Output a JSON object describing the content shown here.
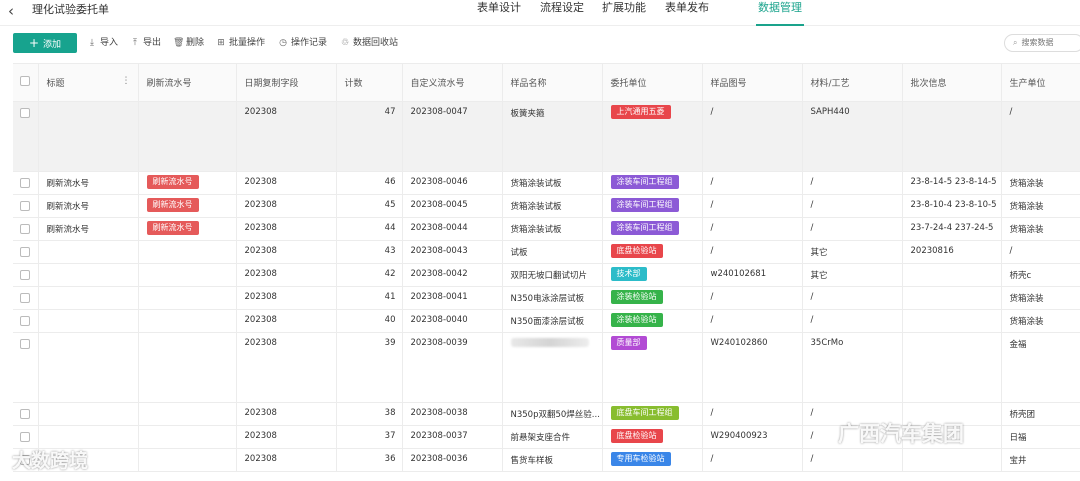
{
  "header": {
    "title": "理化试验委托单",
    "tabs": [
      "表单设计",
      "流程设定",
      "扩展功能",
      "表单发布",
      "数据管理"
    ],
    "active_tab": "数据管理"
  },
  "toolbar": {
    "add": "添加",
    "import": "导入",
    "export": "导出",
    "delete": "删除",
    "batch": "批量操作",
    "log": "操作记录",
    "recycle": "数据回收站",
    "search_placeholder": "搜索数据"
  },
  "columns": [
    "标题",
    "刷新流水号",
    "日期复制字段",
    "计数",
    "自定义流水号",
    "样品名称",
    "委托单位",
    "样品图号",
    "材料/工艺",
    "批次信息",
    "生产单位"
  ],
  "tag_colors": {
    "上汽通用五菱": "#e8464b",
    "刷新流水号": "#e55a5a",
    "涂装车间工程组": "#8c5ad6",
    "底盘检验站": "#e8464b",
    "技术部": "#2cbcc9",
    "涂装检验站": "#36b34a",
    "质量部": "#b24bd4",
    "底盘车间工程组": "#88bd2f",
    "专用车检验站": "#3a86e8"
  },
  "rows": [
    {
      "title": "",
      "refresh": "",
      "date": "202308",
      "count": "47",
      "serial": "202308-0047",
      "sample": "板簧夹箍",
      "unit": "上汽通用五菱",
      "drawing": "/",
      "material": "SAPH440",
      "batch": "",
      "producer": "/"
    },
    {
      "title": "刷新流水号",
      "refresh": "刷新流水号",
      "date": "202308",
      "count": "46",
      "serial": "202308-0046",
      "sample": "货箱涂装试板",
      "unit": "涂装车间工程组",
      "drawing": "/",
      "material": "/",
      "batch": "23-8-14-5   23-8-14-5",
      "producer": "货箱涂装"
    },
    {
      "title": "刷新流水号",
      "refresh": "刷新流水号",
      "date": "202308",
      "count": "45",
      "serial": "202308-0045",
      "sample": "货箱涂装试板",
      "unit": "涂装车间工程组",
      "drawing": "/",
      "material": "/",
      "batch": "23-8-10-4   23-8-10-5",
      "producer": "货箱涂装"
    },
    {
      "title": "刷新流水号",
      "refresh": "刷新流水号",
      "date": "202308",
      "count": "44",
      "serial": "202308-0044",
      "sample": "货箱涂装试板",
      "unit": "涂装车间工程组",
      "drawing": "/",
      "material": "/",
      "batch": "23-7-24-4   237-24-5",
      "producer": "货箱涂装"
    },
    {
      "title": "",
      "refresh": "",
      "date": "202308",
      "count": "43",
      "serial": "202308-0043",
      "sample": "试板",
      "unit": "底盘检验站",
      "drawing": "/",
      "material": "其它",
      "batch": "20230816",
      "producer": "/"
    },
    {
      "title": "",
      "refresh": "",
      "date": "202308",
      "count": "42",
      "serial": "202308-0042",
      "sample": "双阳无坡口翻试切片",
      "unit": "技术部",
      "drawing": "w240102681",
      "material": "其它",
      "batch": "",
      "producer": "桥壳c"
    },
    {
      "title": "",
      "refresh": "",
      "date": "202308",
      "count": "41",
      "serial": "202308-0041",
      "sample": "N350电泳涂层试板",
      "unit": "涂装检验站",
      "drawing": "/",
      "material": "/",
      "batch": "",
      "producer": "货箱涂装"
    },
    {
      "title": "",
      "refresh": "",
      "date": "202308",
      "count": "40",
      "serial": "202308-0040",
      "sample": "N350面漆涂层试板",
      "unit": "涂装检验站",
      "drawing": "/",
      "material": "/",
      "batch": "",
      "producer": "货箱涂装"
    },
    {
      "title": "",
      "refresh": "",
      "date": "202308",
      "count": "39",
      "serial": "202308-0039",
      "sample": "",
      "unit": "质量部",
      "drawing": "W240102860",
      "material": "35CrMo",
      "batch": "",
      "producer": "金福"
    },
    {
      "title": "",
      "refresh": "",
      "date": "202308",
      "count": "38",
      "serial": "202308-0038",
      "sample": "N350p双翻50焊丝验...",
      "unit": "底盘车间工程组",
      "drawing": "/",
      "material": "/",
      "batch": "",
      "producer": "桥壳团"
    },
    {
      "title": "",
      "refresh": "",
      "date": "202308",
      "count": "37",
      "serial": "202308-0037",
      "sample": "前悬架支座合件",
      "unit": "底盘检验站",
      "drawing": "W290400923",
      "material": "/",
      "batch": "",
      "producer": "日福"
    },
    {
      "title": "",
      "refresh": "",
      "date": "202308",
      "count": "36",
      "serial": "202308-0036",
      "sample": "售货车样板",
      "unit": "专用车检验站",
      "drawing": "/",
      "material": "/",
      "batch": "",
      "producer": "宝井"
    }
  ],
  "watermarks": {
    "left": "大数跨境",
    "right": "广西汽车集团"
  }
}
